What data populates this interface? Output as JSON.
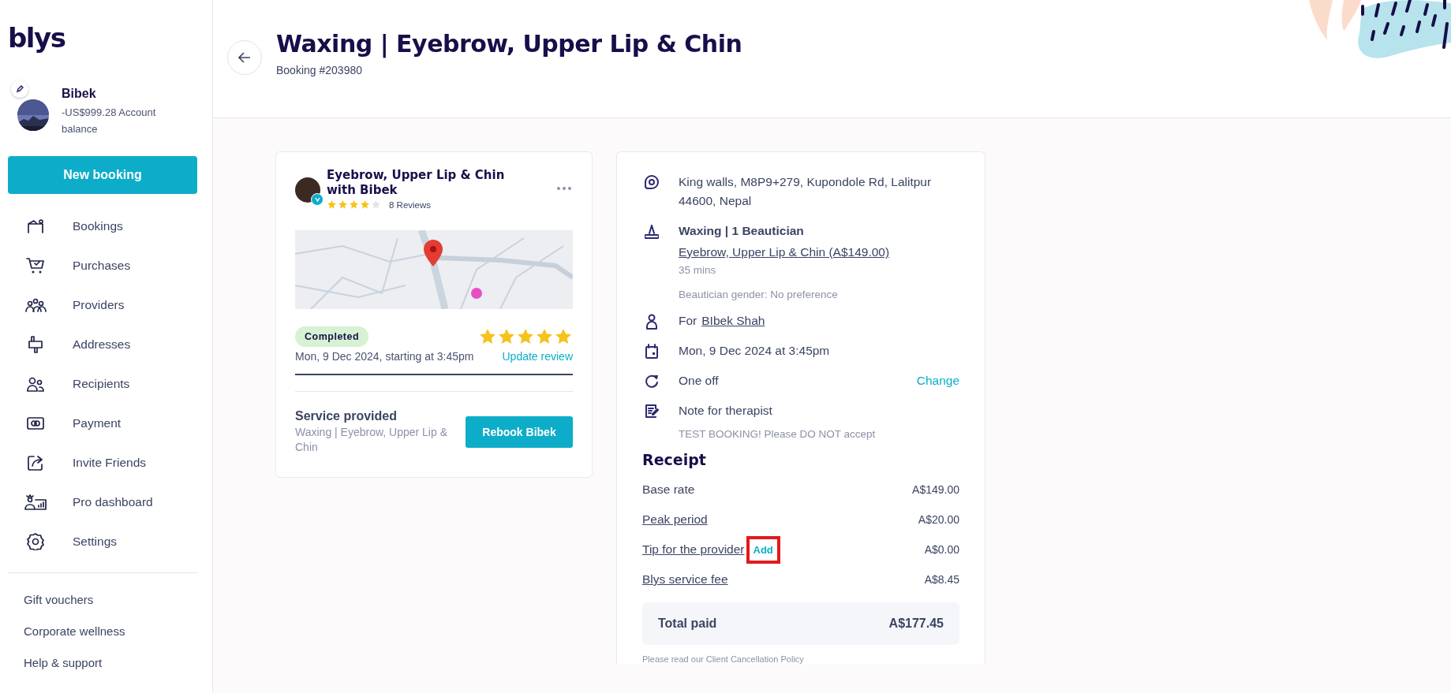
{
  "logo": "blys",
  "user": {
    "name": "Bibek",
    "balance": "-US$999.28 Account balance"
  },
  "new_booking": "New booking",
  "nav": [
    "Bookings",
    "Purchases",
    "Providers",
    "Addresses",
    "Recipients",
    "Payment",
    "Invite Friends",
    "Pro dashboard",
    "Settings"
  ],
  "footer_links": [
    "Gift vouchers",
    "Corporate wellness",
    "Help & support"
  ],
  "header": {
    "title": "Waxing | Eyebrow, Upper Lip & Chin",
    "booking_number": "Booking #203980"
  },
  "provider_card": {
    "title": "Eyebrow, Upper Lip & Chin with Bibek",
    "verified": true,
    "stars": 4,
    "reviews": "8 Reviews",
    "status": "Completed",
    "my_rating": {
      "stars": 5
    },
    "date": "Mon, 9 Dec 2024, starting at 3:45pm",
    "review_link": "Update review",
    "service_label": "Service provided",
    "service": "Waxing | Eyebrow, Upper Lip & Chin",
    "rebook": "Rebook Bibek"
  },
  "details": [
    {
      "kind": "address",
      "text": "King walls, M8P9+279, Kupondole Rd, Lalitpur 44600, Nepal"
    },
    {
      "kind": "service",
      "title": "Waxing | 1 Beautician",
      "link": "Eyebrow, Upper Lip & Chin (A$149.00)",
      "duration": "35 mins",
      "note": "Beautician gender: No preference"
    },
    {
      "kind": "recipient",
      "prefix": "For",
      "link": "BIbek Shah"
    },
    {
      "kind": "date",
      "text": "Mon, 9 Dec 2024 at 3:45pm"
    },
    {
      "kind": "frequency",
      "text": "One off",
      "action": "Change"
    },
    {
      "kind": "note",
      "text": "Note for therapist",
      "note": "TEST BOOKING! Please DO NOT accept"
    }
  ],
  "receipt": {
    "title": "Receipt",
    "rows": [
      {
        "label": "Base rate",
        "link": false,
        "value": "A$149.00"
      },
      {
        "label": "Peak period",
        "link": true,
        "value": "A$20.00"
      },
      {
        "label": "Tip for the provider",
        "link": true,
        "action": "Add",
        "highlighted": true,
        "value": "A$0.00"
      },
      {
        "label": "Blys service fee",
        "link": true,
        "value": "A$8.45"
      }
    ],
    "total_label": "Total paid",
    "total": "A$177.45"
  },
  "policy": "Please read our Client Cancellation Policy"
}
